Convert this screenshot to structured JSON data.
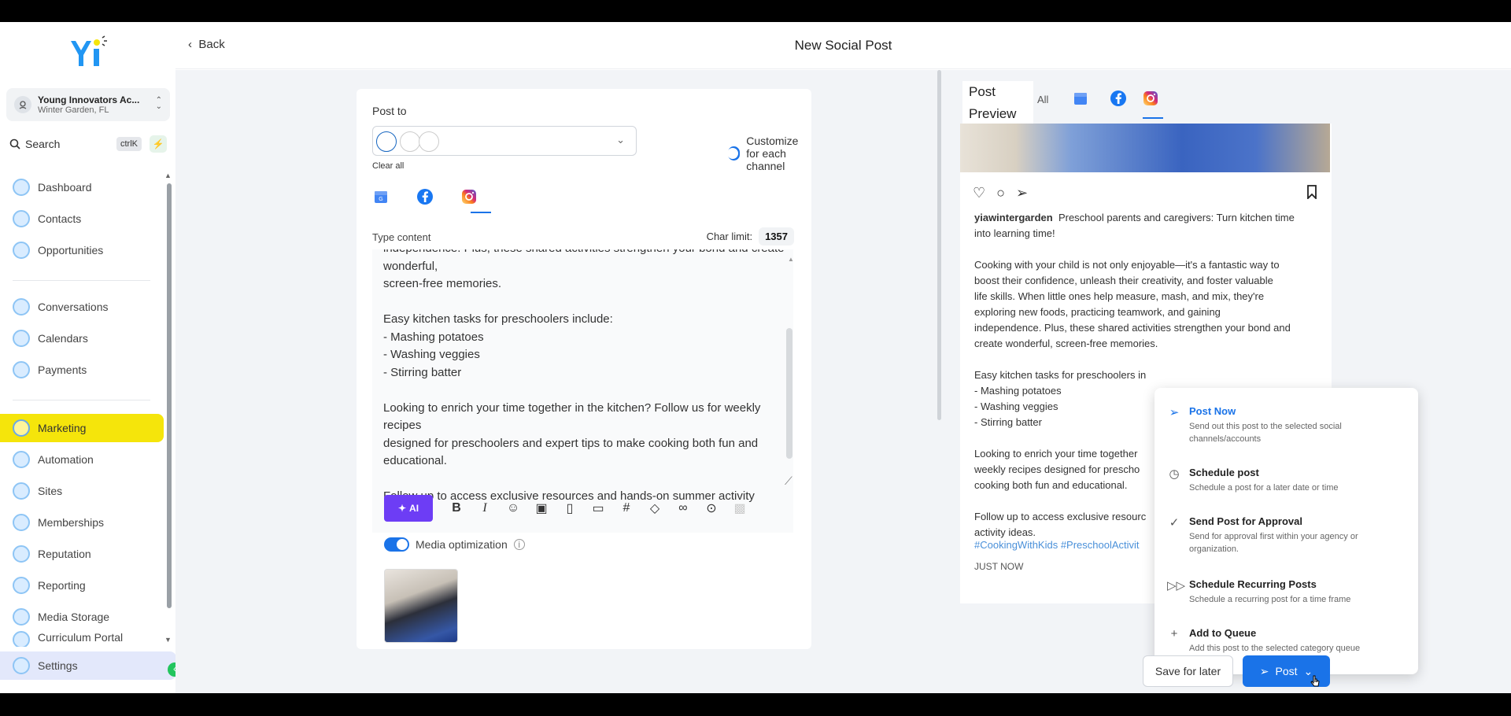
{
  "sidebar": {
    "location_name": "Young Innovators Ac...",
    "location_city": "Winter Garden, FL",
    "search_label": "Search",
    "search_shortcut": "ctrlK",
    "items": [
      {
        "label": "Dashboard"
      },
      {
        "label": "Contacts"
      },
      {
        "label": "Opportunities"
      },
      {
        "label": "Conversations"
      },
      {
        "label": "Calendars"
      },
      {
        "label": "Payments"
      },
      {
        "label": "Marketing"
      },
      {
        "label": "Automation"
      },
      {
        "label": "Sites"
      },
      {
        "label": "Memberships"
      },
      {
        "label": "Reputation"
      },
      {
        "label": "Reporting"
      },
      {
        "label": "Media Storage"
      },
      {
        "label": "Curriculum Portal"
      },
      {
        "label": "Settings"
      }
    ],
    "active_item": "Marketing",
    "active_color": "#f5e50b"
  },
  "header": {
    "back_label": "Back",
    "title": "New Social Post"
  },
  "editor": {
    "post_to_label": "Post to",
    "clear_all": "Clear all",
    "customize_label": "Customize for each channel",
    "customize_on": true,
    "channels": [
      "google-business-icon",
      "facebook-icon",
      "instagram-icon"
    ],
    "selected_channel": "instagram-icon",
    "type_content_label": "Type content",
    "char_limit_label": "Char limit:",
    "char_limit_value": "1357",
    "content_text": "independence. Plus, these shared activities strengthen your bond and create wonderful,\nscreen-free memories.\n\nEasy kitchen tasks for preschoolers include:\n- Mashing potatoes\n- Washing veggies\n- Stirring batter\n\nLooking to enrich your time together in the kitchen? Follow us for weekly recipes\ndesigned for preschoolers and expert tips to make cooking both fun and educational.\n\nFollow up to access exclusive resources and hands-on summer activity ideas.\n\n#CookingWithKids #PreschoolActivities #FamilyCooking",
    "ai_label": "AI",
    "media_opt_label": "Media optimization",
    "media_opt_on": true
  },
  "preview": {
    "title": "Post Preview",
    "tab_all": "All",
    "username": "yiawintergarden",
    "caption": "Preschool parents and caregivers: Turn kitchen time\ninto learning time!\n\nCooking with your child is not only enjoyable—it's a fantastic way to\nboost their confidence, unleash their creativity, and foster valuable\nlife skills. When little ones help measure, mash, and mix, they're\nexploring new foods, practicing teamwork, and gaining\nindependence. Plus, these shared activities strengthen your bond and\ncreate wonderful, screen-free memories.\n\nEasy kitchen tasks for preschoolers in\n- Mashing potatoes\n- Washing veggies\n- Stirring batter\n\nLooking to enrich your time together\nweekly recipes designed for prescho\ncooking both fun and educational.\n\nFollow up to access exclusive resourc\nactivity ideas.",
    "hashtags": "#CookingWithKids #PreschoolActivit",
    "timestamp": "JUST NOW"
  },
  "post_menu": [
    {
      "title": "Post Now",
      "desc": "Send out this post to the selected social channels/accounts",
      "icon": "send-icon"
    },
    {
      "title": "Schedule post",
      "desc": "Schedule a post for a later date or time",
      "icon": "clock-icon"
    },
    {
      "title": "Send Post for Approval",
      "desc": "Send for approval first within your agency or organization.",
      "icon": "check-circle-icon"
    },
    {
      "title": "Schedule Recurring Posts",
      "desc": "Schedule a recurring post for a time frame",
      "icon": "recurring-icon"
    },
    {
      "title": "Add to Queue",
      "desc": "Add this post to the selected category queue",
      "icon": "plus-icon"
    }
  ],
  "footer": {
    "save_later": "Save for later",
    "post": "Post"
  },
  "colors": {
    "primary": "#1a73e8",
    "ai": "#6d3df5"
  }
}
